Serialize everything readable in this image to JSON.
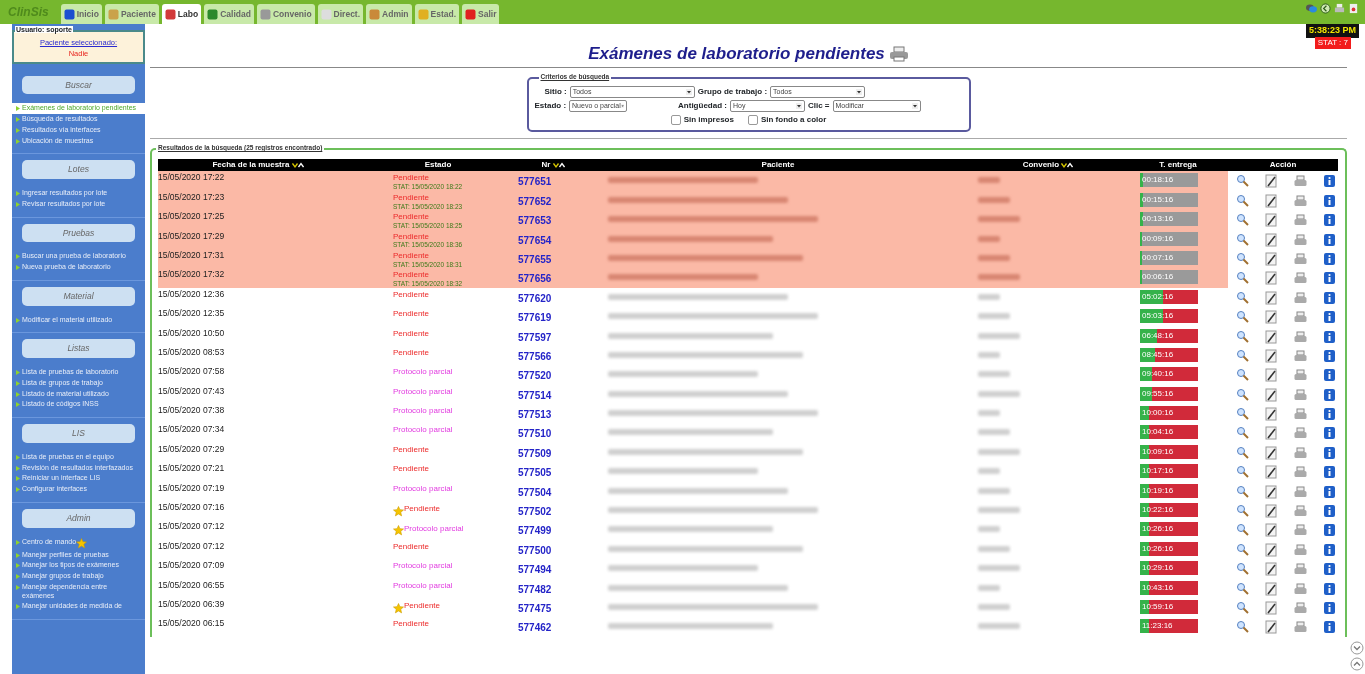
{
  "app": {
    "logo": "ClinSis",
    "user": "Usuario: soporte",
    "patient_label": "Paciente seleccionado:",
    "patient_value": "Nadie",
    "clock": "5:38:23 PM",
    "stat_badge": "STAT : 7"
  },
  "tabs": [
    {
      "label": "Inicio",
      "selected": false
    },
    {
      "label": "Paciente",
      "selected": false
    },
    {
      "label": "Labo",
      "selected": true
    },
    {
      "label": "Calidad",
      "selected": false
    },
    {
      "label": "Convenio",
      "selected": false
    },
    {
      "label": "Direct.",
      "selected": false
    },
    {
      "label": "Admin",
      "selected": false
    },
    {
      "label": "Estad.",
      "selected": false
    },
    {
      "label": "Salir",
      "selected": false
    }
  ],
  "sidebar": [
    {
      "title": "Buscar",
      "items": [
        {
          "label": "Exámenes de laboratorio pendientes",
          "selected": true
        },
        {
          "label": "Búsqueda de resultados",
          "selected": false
        },
        {
          "label": "Resultados vía interfaces",
          "selected": false
        },
        {
          "label": "Ubicación de muestras",
          "selected": false
        }
      ]
    },
    {
      "title": "Lotes",
      "items": [
        {
          "label": "Ingresar resultados por lote",
          "selected": false
        },
        {
          "label": "Revisar resultados por lote",
          "selected": false
        }
      ]
    },
    {
      "title": "Pruebas",
      "items": [
        {
          "label": "Buscar una prueba de laboratorio",
          "selected": false
        },
        {
          "label": "Nueva prueba de laboratorio",
          "selected": false
        }
      ]
    },
    {
      "title": "Material",
      "items": [
        {
          "label": "Modificar el material utilizado",
          "selected": false
        }
      ]
    },
    {
      "title": "Listas",
      "items": [
        {
          "label": "Lista de pruebas de laboratorio",
          "selected": false
        },
        {
          "label": "Lista de grupos de trabajo",
          "selected": false
        },
        {
          "label": "Listado de material utilizado",
          "selected": false
        },
        {
          "label": "Listado de códigos INSS",
          "selected": false
        }
      ]
    },
    {
      "title": "LIS",
      "items": [
        {
          "label": "Lista de pruebas en el equipo",
          "selected": false
        },
        {
          "label": "Revisión de resultados interfazados",
          "selected": false
        },
        {
          "label": "Reiniciar un interface LIS",
          "selected": false
        },
        {
          "label": "Configurar interfaces",
          "selected": false
        }
      ]
    },
    {
      "title": "Admin",
      "items": [
        {
          "label": "Centro de mando",
          "selected": false,
          "starred": true
        },
        {
          "label": "Manejar perfiles de pruebas",
          "selected": false
        },
        {
          "label": "Manejar los tipos de exámenes",
          "selected": false
        },
        {
          "label": "Manejar grupos de trabajo",
          "selected": false
        },
        {
          "label": "Manejar dependencia entre exámenes",
          "selected": false
        },
        {
          "label": "Manejar unidades de medida de",
          "selected": false
        }
      ]
    }
  ],
  "page_title": "Exámenes de laboratorio pendientes",
  "criteria": {
    "legend": "Criterios de búsqueda",
    "field_rows": [
      [
        {
          "label": "Sitio :",
          "value": "Todos"
        },
        {
          "label": "Grupo de trabajo :",
          "value": "Todos"
        }
      ],
      [
        {
          "label": "Estado :",
          "value": "Nuevo o parcial"
        },
        {
          "label": "Antigüedad :",
          "value": "Hoy"
        },
        {
          "label": "Clic =",
          "value": "Modificar"
        }
      ]
    ],
    "checkboxes": [
      {
        "label": "Sin impresos",
        "checked": false
      },
      {
        "label": "Sin fondo a color",
        "checked": false
      }
    ]
  },
  "results": {
    "legend": "Resultados de la búsqueda (25 registros encontrado)",
    "columns": [
      {
        "label": "Fecha de la muestra",
        "sortable": true
      },
      {
        "label": "Estado",
        "sortable": false
      },
      {
        "label": "Nr",
        "sortable": true
      },
      {
        "label": "Paciente",
        "sortable": false
      },
      {
        "label": "Convenio",
        "sortable": true
      },
      {
        "label": "T. entrega",
        "sortable": false
      },
      {
        "label": "Acción",
        "sortable": false
      }
    ],
    "rows": [
      {
        "date": "15/05/2020 17:22",
        "status": "Pendiente",
        "kind": "pendiente",
        "stat": "STAT: 15/05/2020 18:22",
        "starred": false,
        "nr": "577651",
        "time": "00:18:16",
        "level": 0.06
      },
      {
        "date": "15/05/2020 17:23",
        "status": "Pendiente",
        "kind": "pendiente",
        "stat": "STAT: 15/05/2020 18:23",
        "starred": false,
        "nr": "577652",
        "time": "00:15:16",
        "level": 0.06
      },
      {
        "date": "15/05/2020 17:25",
        "status": "Pendiente",
        "kind": "pendiente",
        "stat": "STAT: 15/05/2020 18:25",
        "starred": false,
        "nr": "577653",
        "time": "00:13:16",
        "level": 0.05
      },
      {
        "date": "15/05/2020 17:29",
        "status": "Pendiente",
        "kind": "pendiente",
        "stat": "STAT: 15/05/2020 18:36",
        "starred": false,
        "nr": "577654",
        "time": "00:09:16",
        "level": 0.04
      },
      {
        "date": "15/05/2020 17:31",
        "status": "Pendiente",
        "kind": "pendiente",
        "stat": "STAT: 15/05/2020 18:31",
        "starred": false,
        "nr": "577655",
        "time": "00:07:16",
        "level": 0.03
      },
      {
        "date": "15/05/2020 17:32",
        "status": "Pendiente",
        "kind": "pendiente",
        "stat": "STAT: 15/05/2020 18:32",
        "starred": false,
        "nr": "577656",
        "time": "00:06:16",
        "level": 0.03
      },
      {
        "date": "15/05/2020 12:36",
        "status": "Pendiente",
        "kind": "pendiente",
        "starred": false,
        "nr": "577620",
        "time": "05:02:16",
        "level": 0.4
      },
      {
        "date": "15/05/2020 12:35",
        "status": "Pendiente",
        "kind": "pendiente",
        "starred": false,
        "nr": "577619",
        "time": "05:03:16",
        "level": 0.4
      },
      {
        "date": "15/05/2020 10:50",
        "status": "Pendiente",
        "kind": "pendiente",
        "starred": false,
        "nr": "577597",
        "time": "06:48:16",
        "level": 0.3
      },
      {
        "date": "15/05/2020 08:53",
        "status": "Pendiente",
        "kind": "pendiente",
        "starred": false,
        "nr": "577566",
        "time": "08:45:16",
        "level": 0.25
      },
      {
        "date": "15/05/2020 07:58",
        "status": "Protocolo parcial",
        "kind": "parcial",
        "starred": false,
        "nr": "577520",
        "time": "09:40:16",
        "level": 0.2
      },
      {
        "date": "15/05/2020 07:43",
        "status": "Protocolo parcial",
        "kind": "parcial",
        "starred": false,
        "nr": "577514",
        "time": "09:55:16",
        "level": 0.2
      },
      {
        "date": "15/05/2020 07:38",
        "status": "Protocolo parcial",
        "kind": "parcial",
        "starred": false,
        "nr": "577513",
        "time": "10:00:16",
        "level": 0.15
      },
      {
        "date": "15/05/2020 07:34",
        "status": "Protocolo parcial",
        "kind": "parcial",
        "starred": false,
        "nr": "577510",
        "time": "10:04:16",
        "level": 0.15
      },
      {
        "date": "15/05/2020 07:29",
        "status": "Pendiente",
        "kind": "pendiente",
        "starred": false,
        "nr": "577509",
        "time": "10:09:16",
        "level": 0.15
      },
      {
        "date": "15/05/2020 07:21",
        "status": "Pendiente",
        "kind": "pendiente",
        "starred": false,
        "nr": "577505",
        "time": "10:17:16",
        "level": 0.15
      },
      {
        "date": "15/05/2020 07:19",
        "status": "Protocolo parcial",
        "kind": "parcial",
        "starred": false,
        "nr": "577504",
        "time": "10:19:16",
        "level": 0.15
      },
      {
        "date": "15/05/2020 07:16",
        "status": "Pendiente",
        "kind": "pendiente",
        "starred": true,
        "nr": "577502",
        "time": "10:22:16",
        "level": 0.15
      },
      {
        "date": "15/05/2020 07:12",
        "status": "Protocolo parcial",
        "kind": "parcial",
        "starred": true,
        "nr": "577499",
        "time": "10:26:16",
        "level": 0.15
      },
      {
        "date": "15/05/2020 07:12",
        "status": "Pendiente",
        "kind": "pendiente",
        "starred": false,
        "nr": "577500",
        "time": "10:26:16",
        "level": 0.15
      },
      {
        "date": "15/05/2020 07:09",
        "status": "Protocolo parcial",
        "kind": "parcial",
        "starred": false,
        "nr": "577494",
        "time": "10:29:16",
        "level": 0.15
      },
      {
        "date": "15/05/2020 06:55",
        "status": "Protocolo parcial",
        "kind": "parcial",
        "starred": false,
        "nr": "577482",
        "time": "10:43:16",
        "level": 0.15
      },
      {
        "date": "15/05/2020 06:39",
        "status": "Pendiente",
        "kind": "pendiente",
        "starred": true,
        "nr": "577475",
        "time": "10:59:16",
        "level": 0.15
      },
      {
        "date": "15/05/2020 06:15",
        "status": "Pendiente",
        "kind": "pendiente",
        "starred": false,
        "nr": "577462",
        "time": "11:23:16",
        "level": 0.15
      }
    ]
  }
}
